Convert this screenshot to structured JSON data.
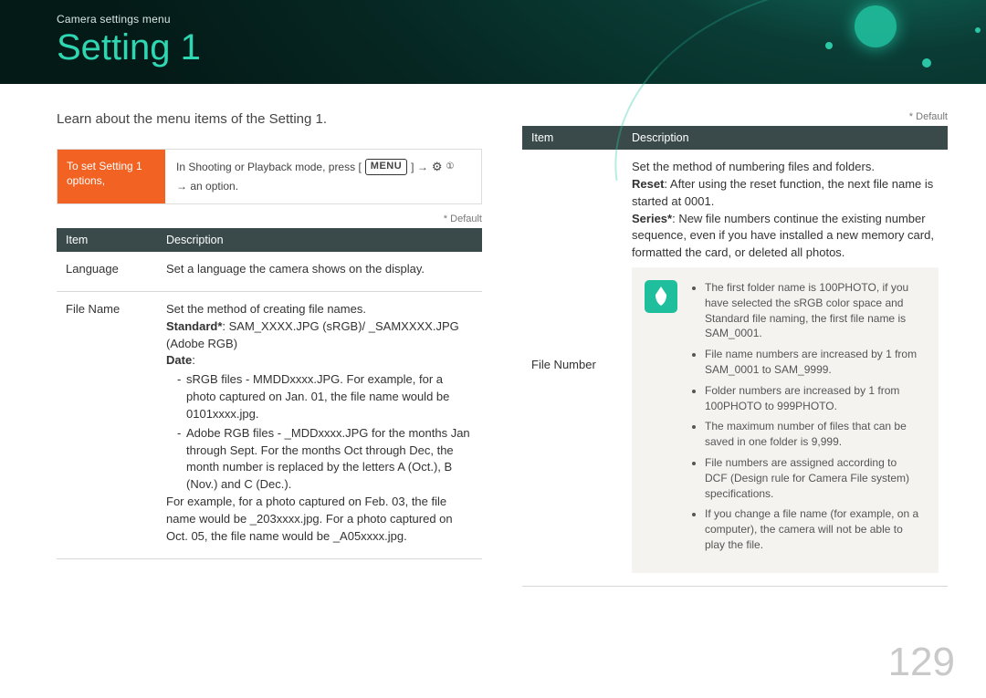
{
  "header": {
    "breadcrumb": "Camera settings menu",
    "title": "Setting 1"
  },
  "intro": "Learn about the menu items of the Setting 1.",
  "default_label": "* Default",
  "instruction": {
    "left": "To set Setting 1 options,",
    "right_pre": "In Shooting or Playback mode, press [",
    "menu_badge": "MENU",
    "right_mid": "] →",
    "gear_sub": "①",
    "right_post": "→ an option."
  },
  "table_headers": {
    "item": "Item",
    "desc": "Description"
  },
  "left_table": {
    "rows": [
      {
        "item": "Language",
        "desc_plain": "Set a language the camera shows on the display."
      },
      {
        "item": "File Name",
        "top": "Set the method of creating file names.",
        "standard_label": "Standard*",
        "standard_rest": ": SAM_XXXX.JPG (sRGB)/ _SAMXXXX.JPG (Adobe RGB)",
        "date_label": "Date",
        "date_colon": ":",
        "bullets": [
          "sRGB files - MMDDxxxx.JPG. For example, for a photo captured on Jan. 01, the file name would be 0101xxxx.jpg.",
          "Adobe RGB files - _MDDxxxx.JPG for the months Jan through Sept. For the months Oct through Dec, the month number is replaced by the letters A (Oct.), B (Nov.) and C (Dec.)."
        ],
        "tail": "For example, for a photo captured on Feb. 03, the file name would be _203xxxx.jpg. For a photo captured on Oct. 05, the file name would be _A05xxxx.jpg."
      }
    ]
  },
  "right_table": {
    "row": {
      "item": "File Number",
      "top": "Set the method of numbering files and folders.",
      "reset_label": "Reset",
      "reset_rest": ": After using the reset function, the next file name is started at 0001.",
      "series_label": "Series*",
      "series_rest": ": New file numbers continue the existing number sequence, even if you have installed a new memory card, formatted the card, or deleted all photos.",
      "notes": [
        "The first folder name is 100PHOTO, if you have selected the sRGB color space and Standard file naming, the first file name is SAM_0001.",
        "File name numbers are increased by 1 from SAM_0001 to SAM_9999.",
        "Folder numbers are increased by 1 from 100PHOTO to 999PHOTO.",
        "The maximum number of files that can be saved in one folder is 9,999.",
        "File numbers are assigned according to DCF (Design rule for Camera File system) specifications.",
        "If you change a file name (for example, on a computer), the camera will not be able to play the file."
      ]
    }
  },
  "page_number": "129"
}
